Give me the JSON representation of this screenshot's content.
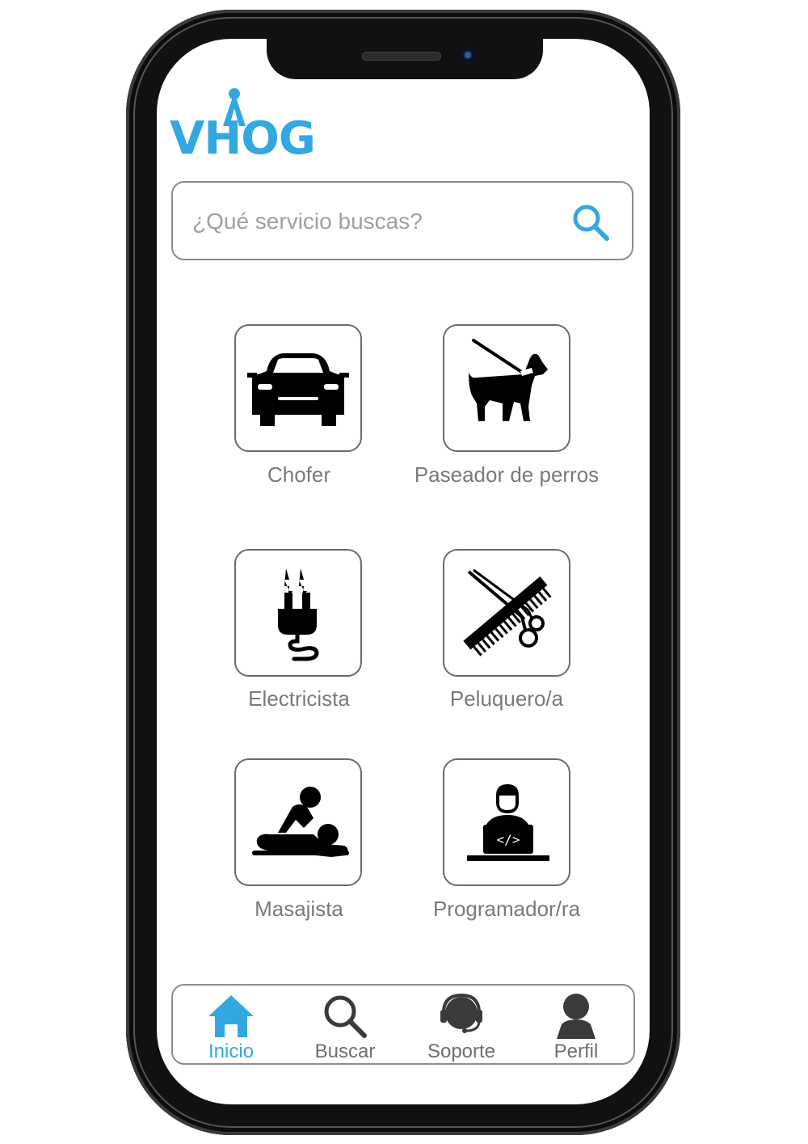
{
  "app": {
    "logo_text": "VHOG",
    "brand_color": "#33a8e0"
  },
  "search": {
    "placeholder": "¿Qué servicio buscas?",
    "value": ""
  },
  "services": [
    {
      "label": "Chofer",
      "icon": "car-icon"
    },
    {
      "label": "Paseador de perros",
      "icon": "dog-walking-icon"
    },
    {
      "label": "Electricista",
      "icon": "electric-plug-icon"
    },
    {
      "label": "Peluquero/a",
      "icon": "comb-scissors-icon"
    },
    {
      "label": "Masajista",
      "icon": "massage-icon"
    },
    {
      "label": "Programador/ra",
      "icon": "programmer-icon"
    }
  ],
  "bottom_nav": {
    "active_index": 0,
    "items": [
      {
        "label": "Inicio",
        "icon": "home-icon"
      },
      {
        "label": "Buscar",
        "icon": "search-icon"
      },
      {
        "label": "Soporte",
        "icon": "headset-icon"
      },
      {
        "label": "Perfil",
        "icon": "user-icon"
      }
    ]
  }
}
